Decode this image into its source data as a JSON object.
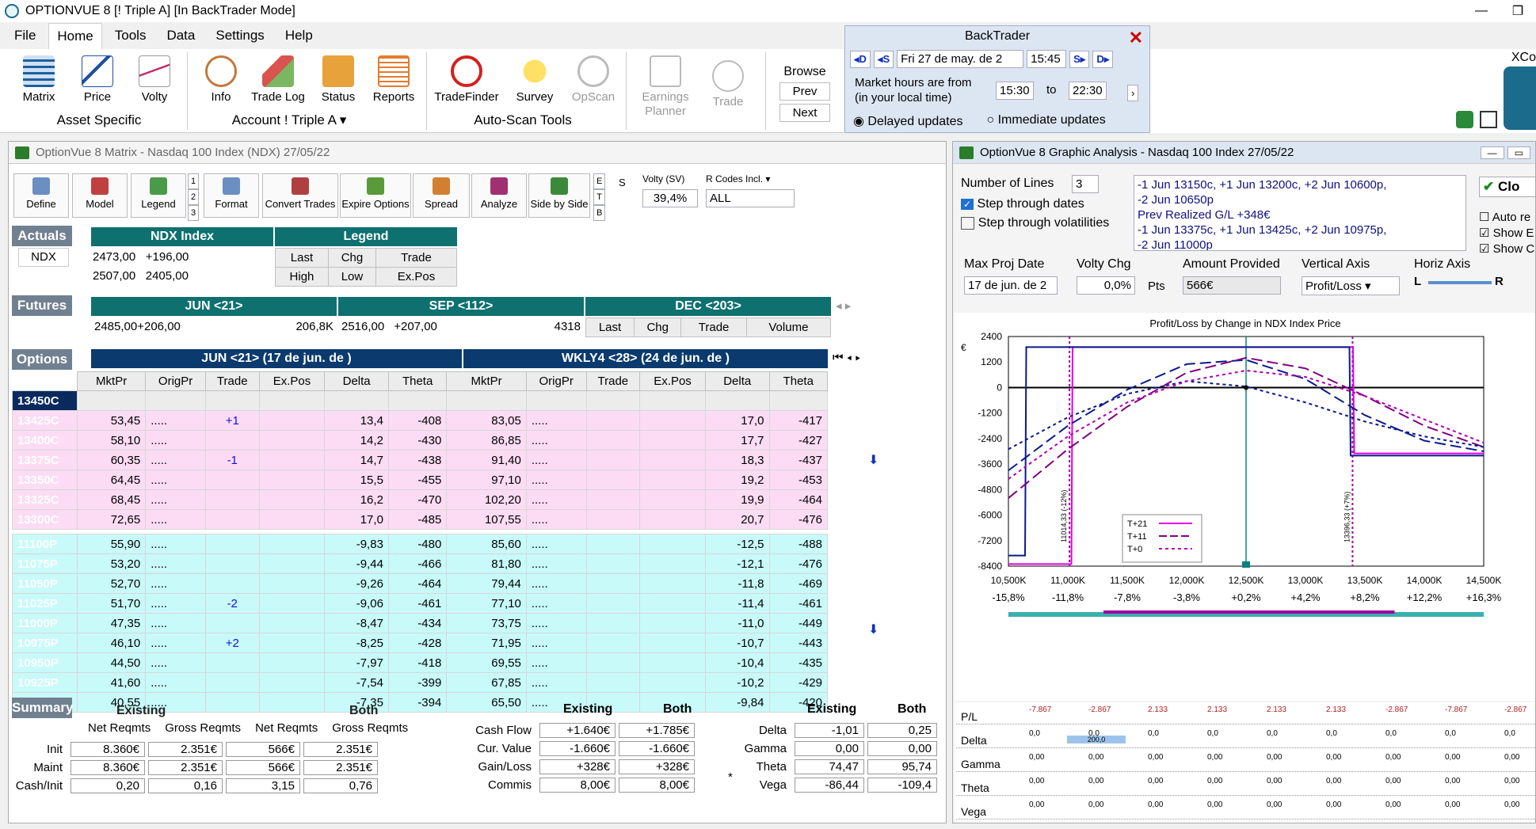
{
  "app": {
    "title": "OPTIONVUE 8  [! Triple A]  [In BackTrader Mode]"
  },
  "menu": [
    "File",
    "Home",
    "Tools",
    "Data",
    "Settings",
    "Help"
  ],
  "ribbon": {
    "asset": [
      "Matrix",
      "Price",
      "Volty"
    ],
    "account": [
      "Info",
      "Trade Log",
      "Status",
      "Reports"
    ],
    "autoscan": [
      "TradeFinder",
      "Survey",
      "OpScan"
    ],
    "other": [
      "Earnings Planner",
      "Trade"
    ],
    "groups": {
      "asset": "Asset Specific",
      "account": "Account ! Triple A",
      "autoscan": "Auto-Scan Tools"
    },
    "browse": {
      "label": "Browse",
      "prev": "Prev",
      "next": "Next"
    }
  },
  "backtrader": {
    "title": "BackTrader",
    "date": "Fri 27 de may. de 2",
    "time": "15:45",
    "hours_label": "Market hours are from",
    "local": "(in your local time)",
    "from": "15:30",
    "to_label": "to",
    "to": "22:30",
    "delayed": "Delayed updates",
    "immediate": "Immediate updates",
    "nav": [
      "D",
      "S",
      "S",
      "D"
    ]
  },
  "xco": "XCo",
  "matrix": {
    "title": "OptionVue 8 Matrix - Nasdaq 100 Index (NDX) 27/05/22",
    "toolbar": [
      "Define",
      "Model",
      "Legend",
      "Format",
      "Convert Trades",
      "Expire Options",
      "Spread",
      "Analyze",
      "Side by Side"
    ],
    "pages": [
      "1",
      "2",
      "3"
    ],
    "etb": [
      "E",
      "T",
      "B"
    ],
    "s": "S",
    "volty_label": "Volty (SV)",
    "volty": "39,4%",
    "rcodes_label": "R Codes Incl.",
    "rcodes": "ALL",
    "actuals": {
      "label": "Actuals",
      "sym": "NDX",
      "idx": "NDX Index",
      "row1": [
        "2473,00",
        "+196,00"
      ],
      "row2": [
        "2507,00",
        "2405,00"
      ],
      "legend": "Legend",
      "leg1": [
        "Last",
        "Chg",
        "Trade"
      ],
      "leg2": [
        "High",
        "Low",
        "Ex.Pos"
      ]
    },
    "futures": {
      "label": "Futures",
      "cols": [
        "JUN <21>",
        "SEP <112>",
        "DEC <203>"
      ],
      "jun": [
        "2485,00",
        "+206,00",
        "206,8K"
      ],
      "sep": [
        "2516,00",
        "+207,00",
        "4318"
      ],
      "dec_hdr": [
        "Last",
        "Chg",
        "Trade",
        "Volume"
      ]
    },
    "options": {
      "label": "Options",
      "exp1": "JUN <21> (17 de jun. de )",
      "exp2": "WKLY4 <28> (24 de jun. de )",
      "cols": [
        "MktPr",
        "OrigPr",
        "Trade",
        "Ex.Pos",
        "Delta",
        "Theta",
        "MktPr",
        "OrigPr",
        "Trade",
        "Ex.Pos",
        "Delta",
        "Theta"
      ],
      "calls": [
        [
          "13450C",
          "",
          "",
          "",
          "",
          "",
          "",
          "",
          "",
          "",
          "",
          "",
          ""
        ],
        [
          "13425C",
          "53,45",
          ".....",
          "+1",
          "",
          "13,4",
          "-408",
          "83,05",
          ".....",
          "",
          "",
          "17,0",
          "-417"
        ],
        [
          "13400C",
          "58,10",
          ".....",
          "",
          "",
          "14,2",
          "-430",
          "86,85",
          ".....",
          "",
          "",
          "17,7",
          "-427"
        ],
        [
          "13375C",
          "60,35",
          ".....",
          "-1",
          "",
          "14,7",
          "-438",
          "91,40",
          ".....",
          "",
          "",
          "18,3",
          "-437"
        ],
        [
          "13350C",
          "64,45",
          ".....",
          "",
          "",
          "15,5",
          "-455",
          "97,10",
          ".....",
          "",
          "",
          "19,2",
          "-453"
        ],
        [
          "13325C",
          "68,45",
          ".....",
          "",
          "",
          "16,2",
          "-470",
          "102,20",
          ".....",
          "",
          "",
          "19,9",
          "-464"
        ],
        [
          "13300C",
          "72,65",
          ".....",
          "",
          "",
          "17,0",
          "-485",
          "107,55",
          ".....",
          "",
          "",
          "20,7",
          "-476"
        ]
      ],
      "puts": [
        [
          "11100P",
          "55,90",
          ".....",
          "",
          "",
          "-9,83",
          "-480",
          "85,60",
          ".....",
          "",
          "",
          "-12,5",
          "-488"
        ],
        [
          "11075P",
          "53,20",
          ".....",
          "",
          "",
          "-9,44",
          "-466",
          "81,80",
          ".....",
          "",
          "",
          "-12,1",
          "-476"
        ],
        [
          "11050P",
          "52,70",
          ".....",
          "",
          "",
          "-9,26",
          "-464",
          "79,44",
          ".....",
          "",
          "",
          "-11,8",
          "-469"
        ],
        [
          "11025P",
          "51,70",
          ".....",
          "-2",
          "",
          "-9,06",
          "-461",
          "77,10",
          ".....",
          "",
          "",
          "-11,4",
          "-461"
        ],
        [
          "11000P",
          "47,35",
          ".....",
          "",
          "",
          "-8,47",
          "-434",
          "73,75",
          ".....",
          "",
          "",
          "-11,0",
          "-449"
        ],
        [
          "10975P",
          "46,10",
          ".....",
          "+2",
          "",
          "-8,25",
          "-428",
          "71,95",
          ".....",
          "",
          "",
          "-10,7",
          "-443"
        ],
        [
          "10950P",
          "44,50",
          ".....",
          "",
          "",
          "-7,97",
          "-418",
          "69,55",
          ".....",
          "",
          "",
          "-10,4",
          "-435"
        ],
        [
          "10925P",
          "41,60",
          ".....",
          "",
          "",
          "-7,54",
          "-399",
          "67,85",
          ".....",
          "",
          "",
          "-10,2",
          "-429"
        ],
        [
          "10900P",
          "40,55",
          ".....",
          "",
          "",
          "-7,35",
          "-394",
          "65,50",
          ".....",
          "",
          "",
          "-9,84",
          "-420"
        ]
      ]
    },
    "summary": {
      "label": "Summary",
      "existing": "Existing",
      "both": "Both",
      "net": "Net Reqmts",
      "gross": "Gross Reqmts",
      "rows": [
        {
          "l": "Init",
          "v": [
            "8.360€",
            "2.351€",
            "566€",
            "2.351€"
          ]
        },
        {
          "l": "Maint",
          "v": [
            "8.360€",
            "2.351€",
            "566€",
            "2.351€"
          ]
        },
        {
          "l": "Cash/Init",
          "v": [
            "0,20",
            "0,16",
            "3,15",
            "0,76"
          ]
        }
      ],
      "mid": [
        {
          "l": "Cash Flow",
          "v": [
            "+1.640€",
            "+1.785€"
          ]
        },
        {
          "l": "Cur. Value",
          "v": [
            "-1.660€",
            "-1.660€"
          ]
        },
        {
          "l": "Gain/Loss",
          "v": [
            "+328€",
            "+328€"
          ]
        },
        {
          "l": "Commis",
          "v": [
            "8,00€",
            "8,00€"
          ]
        }
      ],
      "greeks": [
        {
          "l": "Delta",
          "v": [
            "-1,01",
            "0,25"
          ]
        },
        {
          "l": "Gamma",
          "v": [
            "0,00",
            "0,00"
          ]
        },
        {
          "l": "Theta",
          "v": [
            "74,47",
            "95,74"
          ]
        },
        {
          "l": "Vega",
          "v": [
            "-86,44",
            "-109,4"
          ]
        }
      ],
      "star": "*"
    }
  },
  "graph": {
    "title": "OptionVue 8 Graphic Analysis - Nasdaq 100 Index 27/05/22",
    "nlines_label": "Number of Lines",
    "nlines": "3",
    "step_dates": "Step through dates",
    "step_vol": "Step through volatilities",
    "desc": [
      "-1 Jun 13150c, +1 Jun 13200c, +2 Jun 10600p,",
      "-2 Jun 10650p",
      "Prev Realized G/L +348€",
      "-1 Jun 13375c, +1 Jun 13425c, +2 Jun 10975p,",
      "-2 Jun 11000p"
    ],
    "close": "Clo",
    "chk": [
      "Auto re",
      "Show E",
      "Show C"
    ],
    "maxproj_label": "Max Proj Date",
    "maxproj": "17 de jun. de 2",
    "vchg_label": "Volty Chg",
    "vchg": "0,0%",
    "pts": "Pts",
    "amount_label": "Amount Provided",
    "amount": "566€",
    "vaxis_label": "Vertical Axis",
    "vaxis": "Profit/Loss",
    "haxis_label": "Horiz Axis",
    "L": "L",
    "R": "R"
  },
  "chart_data": {
    "type": "line",
    "title": "Profit/Loss by Change in NDX Index Price",
    "yunit": "€",
    "yticks": [
      "2400",
      "1200",
      "0",
      "-1200",
      "-2400",
      "-3600",
      "-4800",
      "-6000",
      "-7200",
      "-8400"
    ],
    "xticks": [
      "10,500K",
      "11,000K",
      "11,500K",
      "12,000K",
      "12,500K",
      "13,000K",
      "13,500K",
      "14,000K",
      "14,500K"
    ],
    "xpct": [
      "-15,8%",
      "-11,8%",
      "-7,8%",
      "-3,8%",
      "+0,2%",
      "+4,2%",
      "+8,2%",
      "+12,2%",
      "+16,3%"
    ],
    "xlim": [
      10500,
      14500
    ],
    "ylim": [
      -8400,
      2400
    ],
    "legend": [
      "T+21",
      "T+11",
      "T+0"
    ],
    "vlines": [
      {
        "x": 11014,
        "label": "11014,33 (-12%)"
      },
      {
        "x": 13396,
        "label": "13396,33 (+7%)"
      }
    ],
    "series": [
      {
        "name": "T+21",
        "color": "#e000e0",
        "x": [
          10500,
          11030,
          11040,
          13400,
          13410,
          14500
        ],
        "y": [
          -8300,
          -8300,
          1900,
          1900,
          -3100,
          -3100
        ]
      },
      {
        "name": "T+21",
        "color": "#0a1a8a",
        "x": [
          10500,
          10640,
          10650,
          13370,
          13380,
          14500
        ],
        "y": [
          -7900,
          -7900,
          1900,
          1900,
          -3200,
          -3200
        ]
      },
      {
        "name": "T+11",
        "color": "#0a1a8a",
        "x": [
          10500,
          11000,
          11500,
          12000,
          12500,
          13000,
          13500,
          14000,
          14500
        ],
        "y": [
          -3900,
          -1800,
          -100,
          1100,
          1300,
          400,
          -1300,
          -2500,
          -3000
        ]
      },
      {
        "name": "T+11",
        "color": "#800080",
        "x": [
          10500,
          11000,
          11500,
          12000,
          12500,
          13000,
          13500,
          14000,
          14500
        ],
        "y": [
          -5200,
          -2900,
          -900,
          700,
          1400,
          900,
          -400,
          -1800,
          -2800
        ]
      },
      {
        "name": "T+0",
        "color": "#0a1a8a",
        "x": [
          10500,
          11000,
          11500,
          12000,
          12500,
          13000,
          13500,
          14000,
          14500
        ],
        "y": [
          -2900,
          -1400,
          -300,
          300,
          50,
          -700,
          -1600,
          -2300,
          -2800
        ]
      },
      {
        "name": "T+0",
        "color": "#b000b0",
        "x": [
          10500,
          11000,
          11500,
          12000,
          12500,
          13000,
          13500,
          14000,
          14500
        ],
        "y": [
          -4300,
          -2300,
          -700,
          300,
          800,
          500,
          -400,
          -1500,
          -2600
        ]
      }
    ]
  },
  "greekrows": {
    "labels": [
      "P/L",
      "Delta",
      "Gamma",
      "Theta",
      "Vega"
    ],
    "pl": [
      "-7.867",
      "-2.867",
      "2.133",
      "2.133",
      "2.133",
      "2.133",
      "-2.867",
      "-7.867",
      "-2.867"
    ],
    "delta_hl": "200,0",
    "zero": "0,0",
    "zero2": "0,00"
  },
  "colors": {
    "teal": "#0f7070",
    "navy": "#0a2a5e",
    "pink": "#fbdcf4",
    "cyan": "#c8fafa"
  }
}
